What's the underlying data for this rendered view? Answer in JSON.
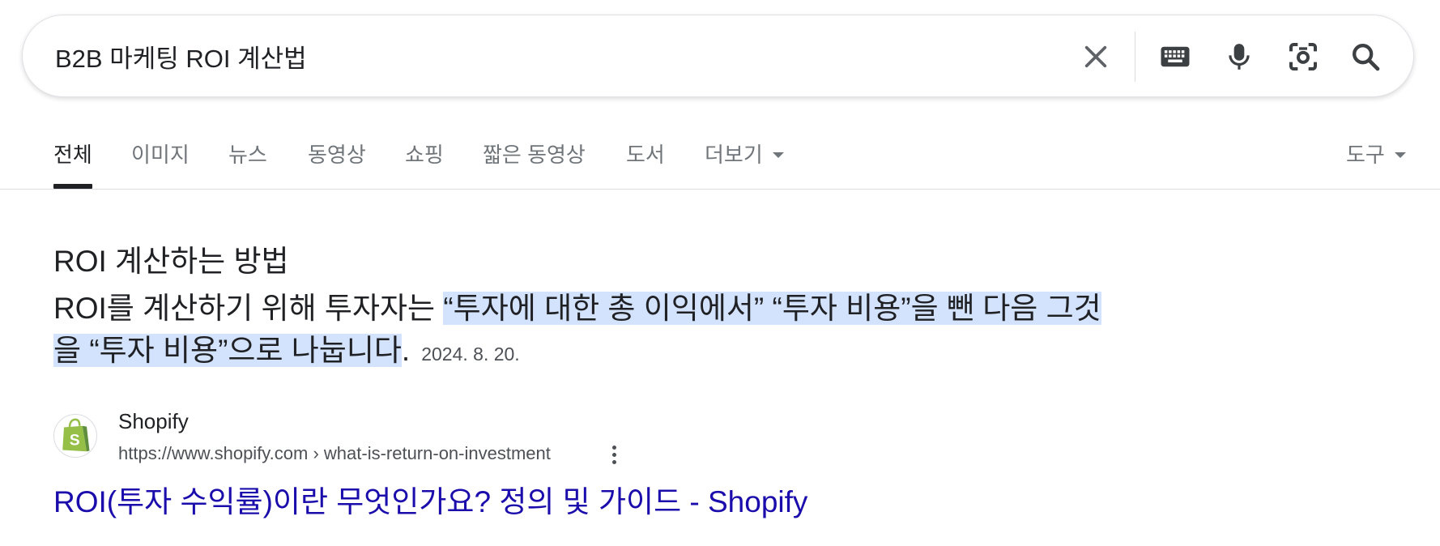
{
  "search": {
    "query": "B2B 마케팅 ROI 계산법",
    "icons": [
      "close-icon",
      "keyboard-icon",
      "microphone-icon",
      "lens-icon",
      "search-icon"
    ]
  },
  "tabs": {
    "all": "전체",
    "images": "이미지",
    "news": "뉴스",
    "videos": "동영상",
    "shopping": "쇼핑",
    "short_videos": "짧은 동영상",
    "books": "도서",
    "more": "더보기",
    "tools": "도구",
    "active": "전체"
  },
  "snippet": {
    "heading": "ROI 계산하는 방법",
    "text_before": "ROI를 계산하기 위해 투자자는 ",
    "highlighted": "“투자에 대한 총 이익에서” “투자 비용”을 뺀 다음 그것을 “투자 비용”으로 나눕니다",
    "text_after": ".",
    "date": "2024. 8. 20."
  },
  "result": {
    "site_name": "Shopify",
    "url": "https://www.shopify.com › what-is-return-on-investment",
    "title": "ROI(투자 수익률)이란 무엇인가요? 정의 및 가이드 - Shopify",
    "favicon": "shopify-bag-icon"
  },
  "colors": {
    "link": "#1a0dab",
    "highlight": "#d3e3fd",
    "shopify_green": "#95bf47"
  }
}
